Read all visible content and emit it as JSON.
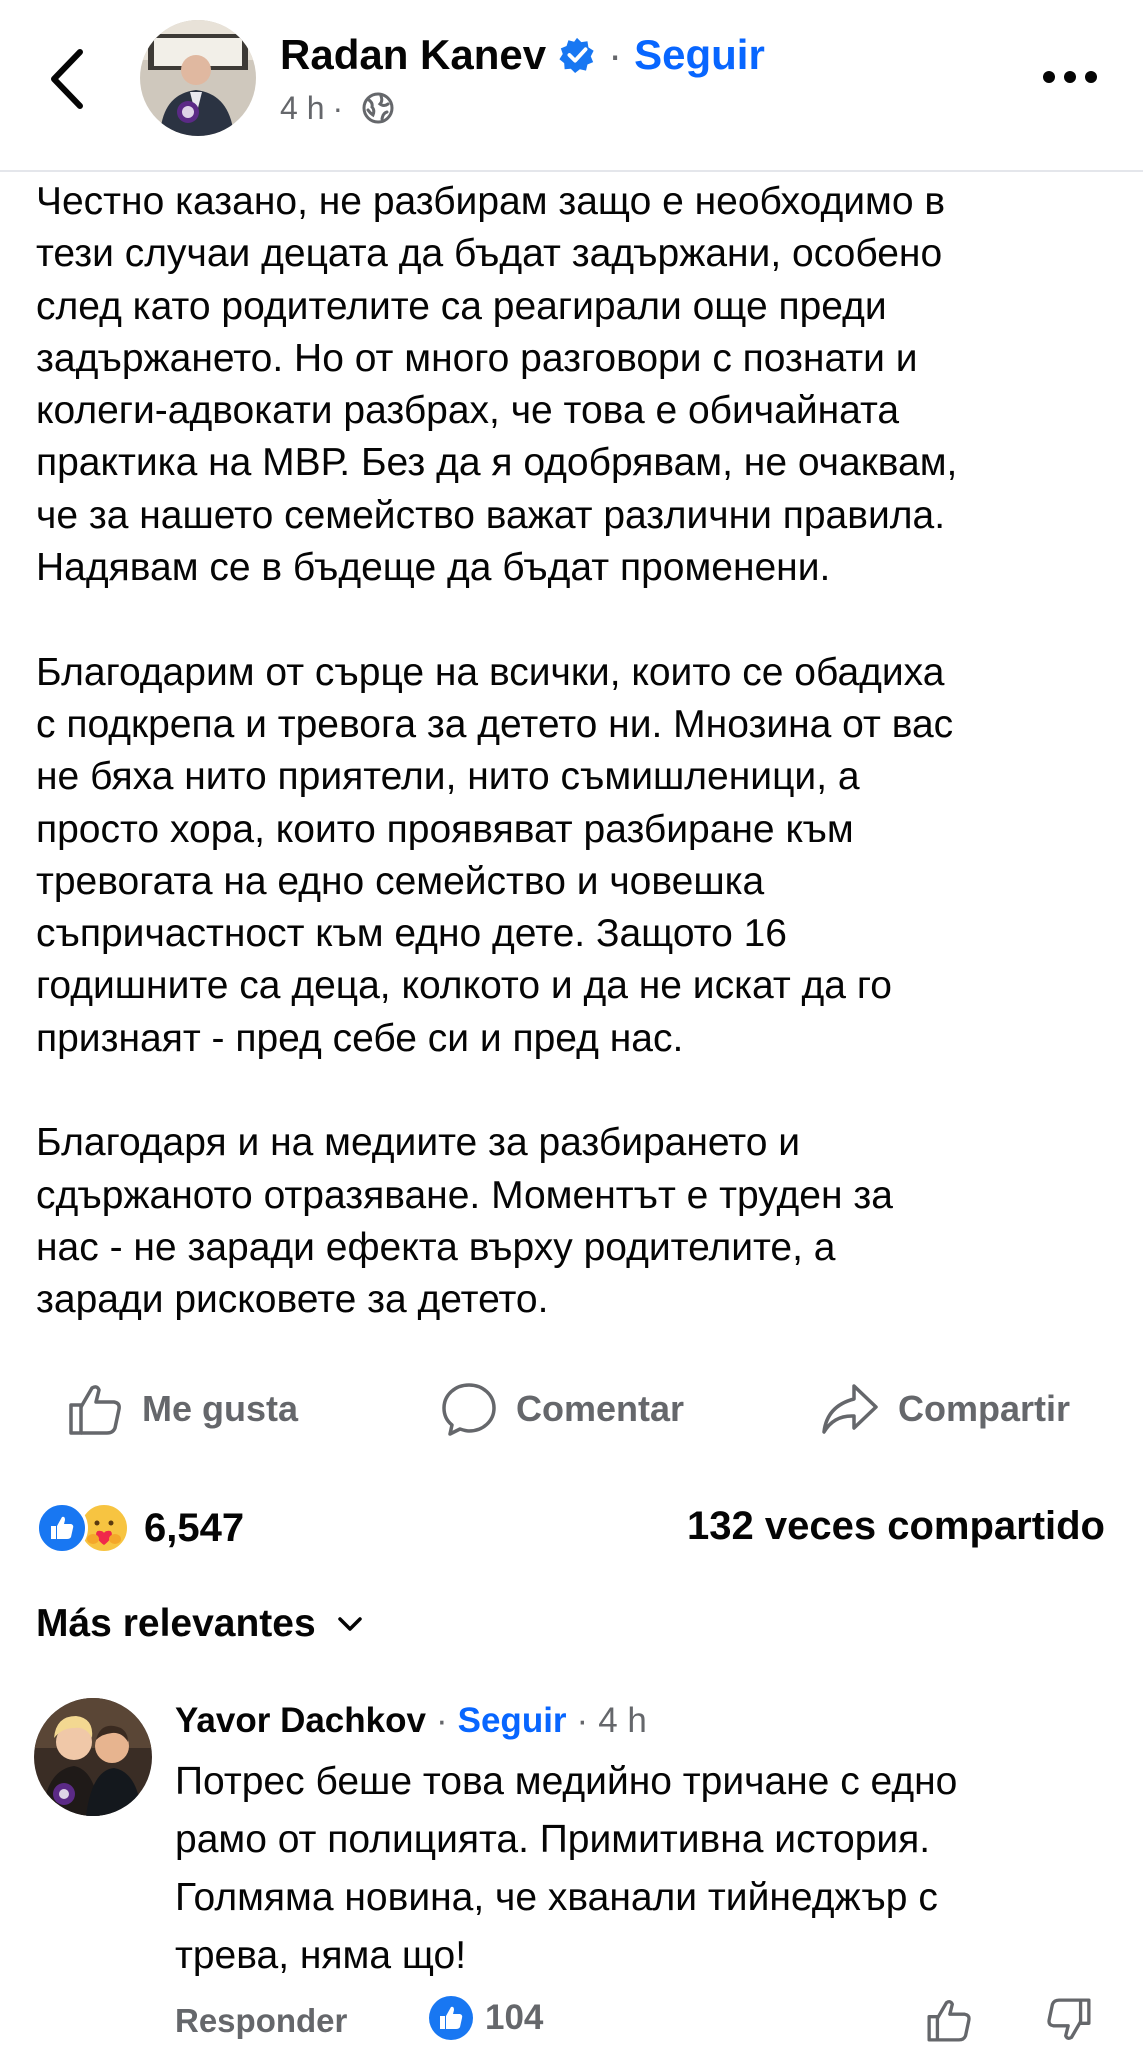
{
  "header": {
    "author": "Radan Kanev",
    "separator": "·",
    "follow_label": "Seguir",
    "time": "4 h",
    "time_separator": "·",
    "privacy_icon": "globe-icon"
  },
  "post": {
    "paragraphs": [
      [
        "Честно казано, не разбирам защо е необходимо в",
        "тези случаи децата да бъдат задържани, особено",
        "след като родителите са реагирали още преди",
        "задържането. Но от много разговори с познати и",
        "колеги-адвокати разбрах, че това е обичайната",
        "практика на МВР. Без да я одобрявам, не очаквам,",
        "че за нашето семейство важат различни правила.",
        "Надявам се в бъдеще да бъдат променени."
      ],
      [
        "Благодарим от сърце на  всички, които се обадиха",
        "с подкрепа и тревога за детето ни. Мнозина от вас",
        "не бяха нито приятели, нито съмишленици, а",
        "просто хора, които проявяват разбиране към",
        "тревогата на едно семейство и човешка",
        "съпричастност към едно дете. Защото 16",
        "годишните са деца, колкото и да не искат да го",
        "признаят - пред себе си и пред нас."
      ],
      [
        "Благодаря и на медиите за разбирането и",
        "сдържаното отразяване. Моментът е труден за",
        "нас - не заради ефекта върху родителите, а",
        "заради рисковете за детето."
      ]
    ]
  },
  "actions": {
    "like_label": "Me gusta",
    "comment_label": "Comentar",
    "share_label": "Compartir"
  },
  "stats": {
    "reactions_count": "6,547",
    "shares_text": "132 veces compartido"
  },
  "comments_sort": {
    "label": "Más relevantes"
  },
  "comment": {
    "author": "Yavor Dachkov",
    "separator": "·",
    "follow_label": "Seguir",
    "time_separator": "·",
    "time": "4 h",
    "lines": [
      "Потрес беше това медийно тричане с едно",
      "рамо от полицията. Примитивна история.",
      "Голмяма новина, че хванали тийнеджър с",
      "трева, няма що!"
    ],
    "reply_label": "Responder",
    "likes": "104"
  },
  "colors": {
    "accent": "#0866ff",
    "like_blue": "#1877f2",
    "secondary_text": "#65676b",
    "divider": "#e4e6eb"
  }
}
